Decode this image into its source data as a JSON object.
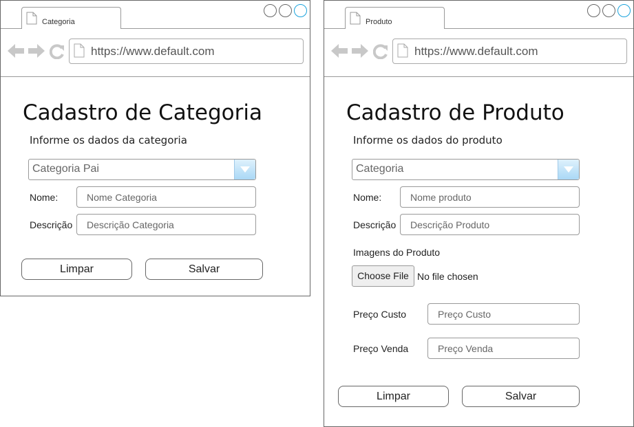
{
  "colors": {
    "accent": "#1aa3dc",
    "dropdown": "#a9d8f6"
  },
  "icons": [
    "document-icon",
    "back-arrow-icon",
    "forward-arrow-icon",
    "reload-icon",
    "window-control-icon",
    "dropdown-arrow-icon"
  ],
  "win1": {
    "tab_label": "Categoria",
    "url": "https://www.default.com",
    "title": "Cadastro de Categoria",
    "subtitle": "Informe os dados da categoria",
    "select_value": "Categoria Pai",
    "fields": [
      {
        "label": "Nome:",
        "placeholder": "Nome Categoria"
      },
      {
        "label": "Descrição",
        "placeholder": "Descrição Categoria"
      }
    ],
    "btn_clear": "Limpar",
    "btn_save": "Salvar"
  },
  "win2": {
    "tab_label": "Produto",
    "url": "https://www.default.com",
    "title": "Cadastro de Produto",
    "subtitle": "Informe os dados do produto",
    "select_value": "Categoria",
    "fields": [
      {
        "label": "Nome:",
        "placeholder": "Nome produto"
      },
      {
        "label": "Descrição",
        "placeholder": "Descrição Produto"
      }
    ],
    "images_label": "Imagens do Produto",
    "file_button": "Choose File",
    "file_status": "No file chosen",
    "price_fields": [
      {
        "label": "Preço Custo",
        "placeholder": "Preço Custo"
      },
      {
        "label": "Preço Venda",
        "placeholder": "Preço Venda"
      }
    ],
    "btn_clear": "Limpar",
    "btn_save": "Salvar"
  }
}
